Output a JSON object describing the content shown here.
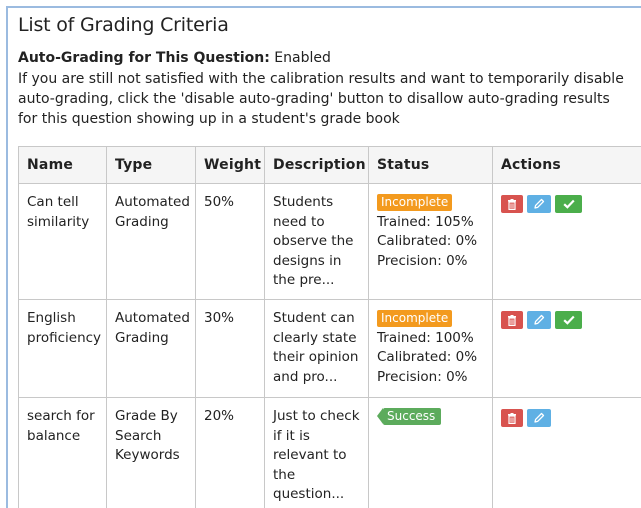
{
  "page": {
    "title": "List of Grading Criteria",
    "auto_label": "Auto-Grading for This Question:",
    "auto_value": "Enabled",
    "note": "If you are still not satisfied with the calibration results and want to temporarily disable auto-grading, click the 'disable auto-grading' button to disallow auto-grading results for this question showing up in a student's grade book"
  },
  "table": {
    "headers": [
      "Name",
      "Type",
      "Weight",
      "Description",
      "Status",
      "Actions"
    ],
    "rows": [
      {
        "name": "Can tell similarity",
        "type": "Automated Grading",
        "weight": "50%",
        "description": "Students need to observe the designs in the pre...",
        "badge": "Incomplete",
        "trained": "Trained: 105%",
        "calibrated": "Calibrated: 0%",
        "precision": "Precision: 0%"
      },
      {
        "name": "English proficiency",
        "type": "Automated Grading",
        "weight": "30%",
        "description": "Student can clearly state their opinion and pro...",
        "badge": "Incomplete",
        "trained": "Trained: 100%",
        "calibrated": "Calibrated: 0%",
        "precision": "Precision: 0%"
      },
      {
        "name": "search for balance",
        "type": "Grade By Search Keywords",
        "weight": "20%",
        "description": "Just to check if it is relevant to the question...",
        "badge": "Success"
      }
    ]
  },
  "colors": {
    "incomplete": "#f39a1e",
    "success": "#5cab5c",
    "delete": "#d8534f",
    "edit": "#5fb0e4",
    "approve": "#4bae4b"
  },
  "icons": [
    "trash-icon",
    "pencil-icon",
    "checkmark-icon"
  ]
}
